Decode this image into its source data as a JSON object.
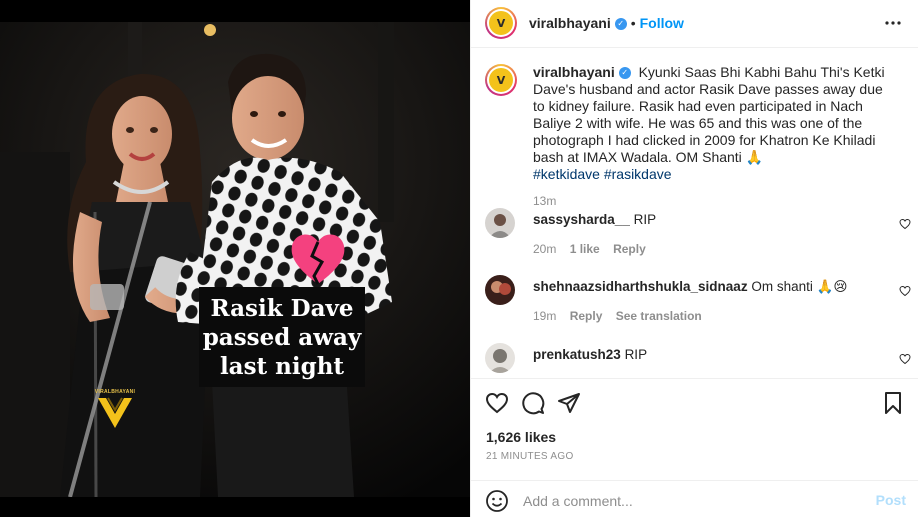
{
  "media": {
    "caption_lines": [
      "Rasik Dave",
      "passed away",
      "last night"
    ],
    "watermark_text": "VIRALBHAYANI",
    "icons": [
      "broken-heart-icon",
      "viralbhayani-logo-icon"
    ]
  },
  "header": {
    "username": "viralbhayani",
    "verified": true,
    "separator": "•",
    "follow_label": "Follow",
    "more_icon": "more-options-icon"
  },
  "caption": {
    "username": "viralbhayani",
    "text": "Kyunki Saas Bhi Kabhi Bahu Thi's Ketki Dave's husband and actor Rasik Dave passes away due to kidney failure. Rasik had even participated in Nach Baliye 2 with wife. He was 65 and this was one of the photograph I had clicked in 2009 for Khatron Ke Khiladi bash at IMAX Wadala. OM Shanti 🙏",
    "hashtags": [
      "#ketkidave",
      "#rasikdave"
    ],
    "time": "13m"
  },
  "comments": [
    {
      "username": "sassysharda__",
      "text": "RIP",
      "time": "20m",
      "likes": "1 like",
      "reply": "Reply",
      "translate": ""
    },
    {
      "username": "shehnaazsidharthshukla_sidnaaz",
      "text": "Om shanti 🙏😢",
      "time": "19m",
      "likes": "",
      "reply": "Reply",
      "translate": "See translation"
    },
    {
      "username": "prenkatush23",
      "text": "RIP",
      "time": "",
      "likes": "",
      "reply": "",
      "translate": ""
    }
  ],
  "actions": {
    "likes": "1,626 likes",
    "time_ago": "21 MINUTES AGO",
    "icons": [
      "heart-icon",
      "comment-icon",
      "share-icon",
      "bookmark-icon"
    ]
  },
  "add_comment": {
    "placeholder": "Add a comment...",
    "post_label": "Post"
  },
  "colors": {
    "accent": "#0095f6",
    "verified": "#3897f0",
    "muted": "#8e8e8e",
    "text": "#262626",
    "post_disabled": "#b2dffc"
  }
}
